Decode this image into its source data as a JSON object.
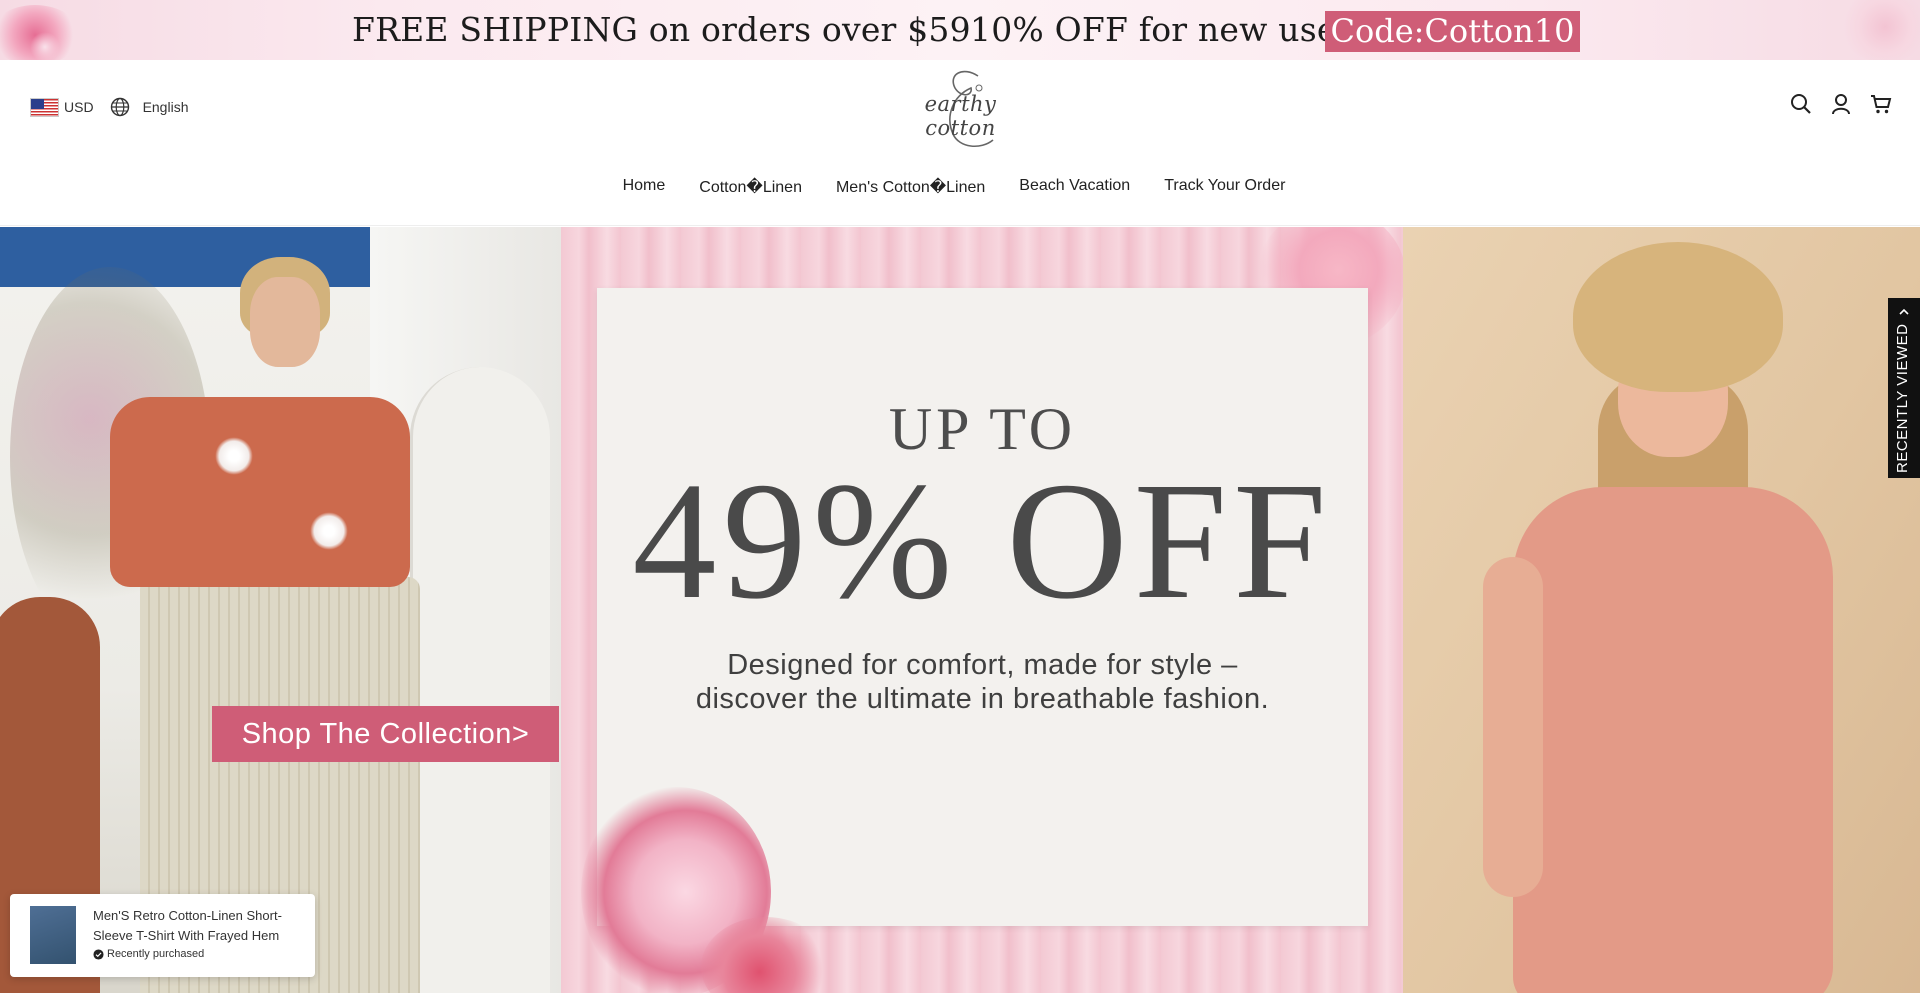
{
  "promo": {
    "shipping": "FREE SHIPPING on orders over $59",
    "discount": "10% OFF for new user",
    "code": "Code:Cotton10"
  },
  "header": {
    "currency": "USD",
    "language": "English",
    "logo_text": "earthy cotton",
    "icons": [
      "search-icon",
      "user-icon",
      "cart-icon"
    ]
  },
  "nav": {
    "items": [
      {
        "label": "Home"
      },
      {
        "label": "Cotton�Linen"
      },
      {
        "label": "Men's Cotton�Linen"
      },
      {
        "label": "Beach Vacation"
      },
      {
        "label": "Track Your Order"
      }
    ]
  },
  "hero": {
    "upto": "UP TO",
    "headline": "49% OFF",
    "description_line1": "Designed for comfort, made for style –",
    "description_line2": "discover the ultimate in breathable fashion.",
    "cta": "Shop The Collection>"
  },
  "recently_viewed": {
    "label": "RECENTLY VIEWED"
  },
  "toast": {
    "title": "Men'S Retro Cotton-Linen Short-Sleeve T-Shirt With Frayed Hem",
    "subtitle": "Recently purchased"
  },
  "colors": {
    "accent": "#cf5d77",
    "promo_bg": "#fbe9ef",
    "text": "#222222"
  }
}
